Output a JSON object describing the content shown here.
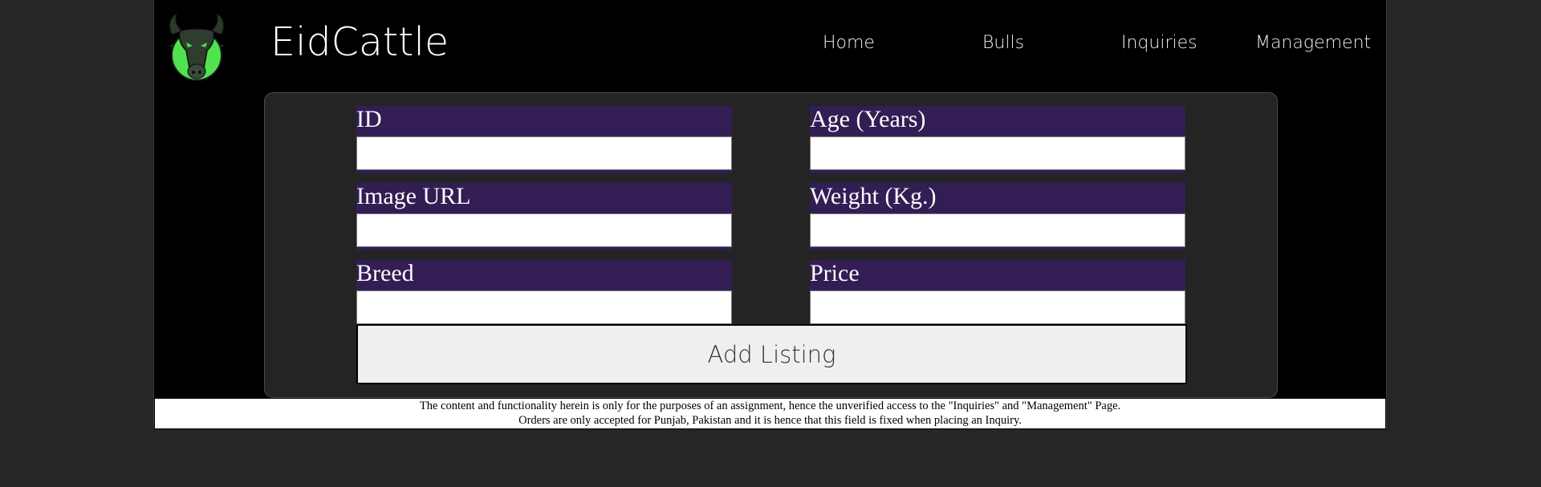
{
  "header": {
    "brand": "EidCattle",
    "logo_icon": "bull-head-icon",
    "nav": [
      "Home",
      "Bulls",
      "Inquiries",
      "Management"
    ]
  },
  "form": {
    "fields": [
      {
        "label": "ID",
        "value": ""
      },
      {
        "label": "Age (Years)",
        "value": ""
      },
      {
        "label": "Image URL",
        "value": ""
      },
      {
        "label": "Weight (Kg.)",
        "value": ""
      },
      {
        "label": "Breed",
        "value": ""
      },
      {
        "label": "Price",
        "value": ""
      }
    ],
    "submit_label": "Add Listing"
  },
  "footer": {
    "line1": "The content and functionality herein is only for the purposes of an assignment, hence the unverified access to the \"Inquiries\" and \"Management\" Page.",
    "line2": "Orders are only accepted for Punjab, Pakistan and it is hence that this field is fixed when placing an Inquiry."
  },
  "colors": {
    "background": "#262626",
    "page": "#000000",
    "panel": "#242424",
    "field_bg": "#321e54",
    "logo_green": "#4fe34f",
    "button": "#efefef"
  }
}
